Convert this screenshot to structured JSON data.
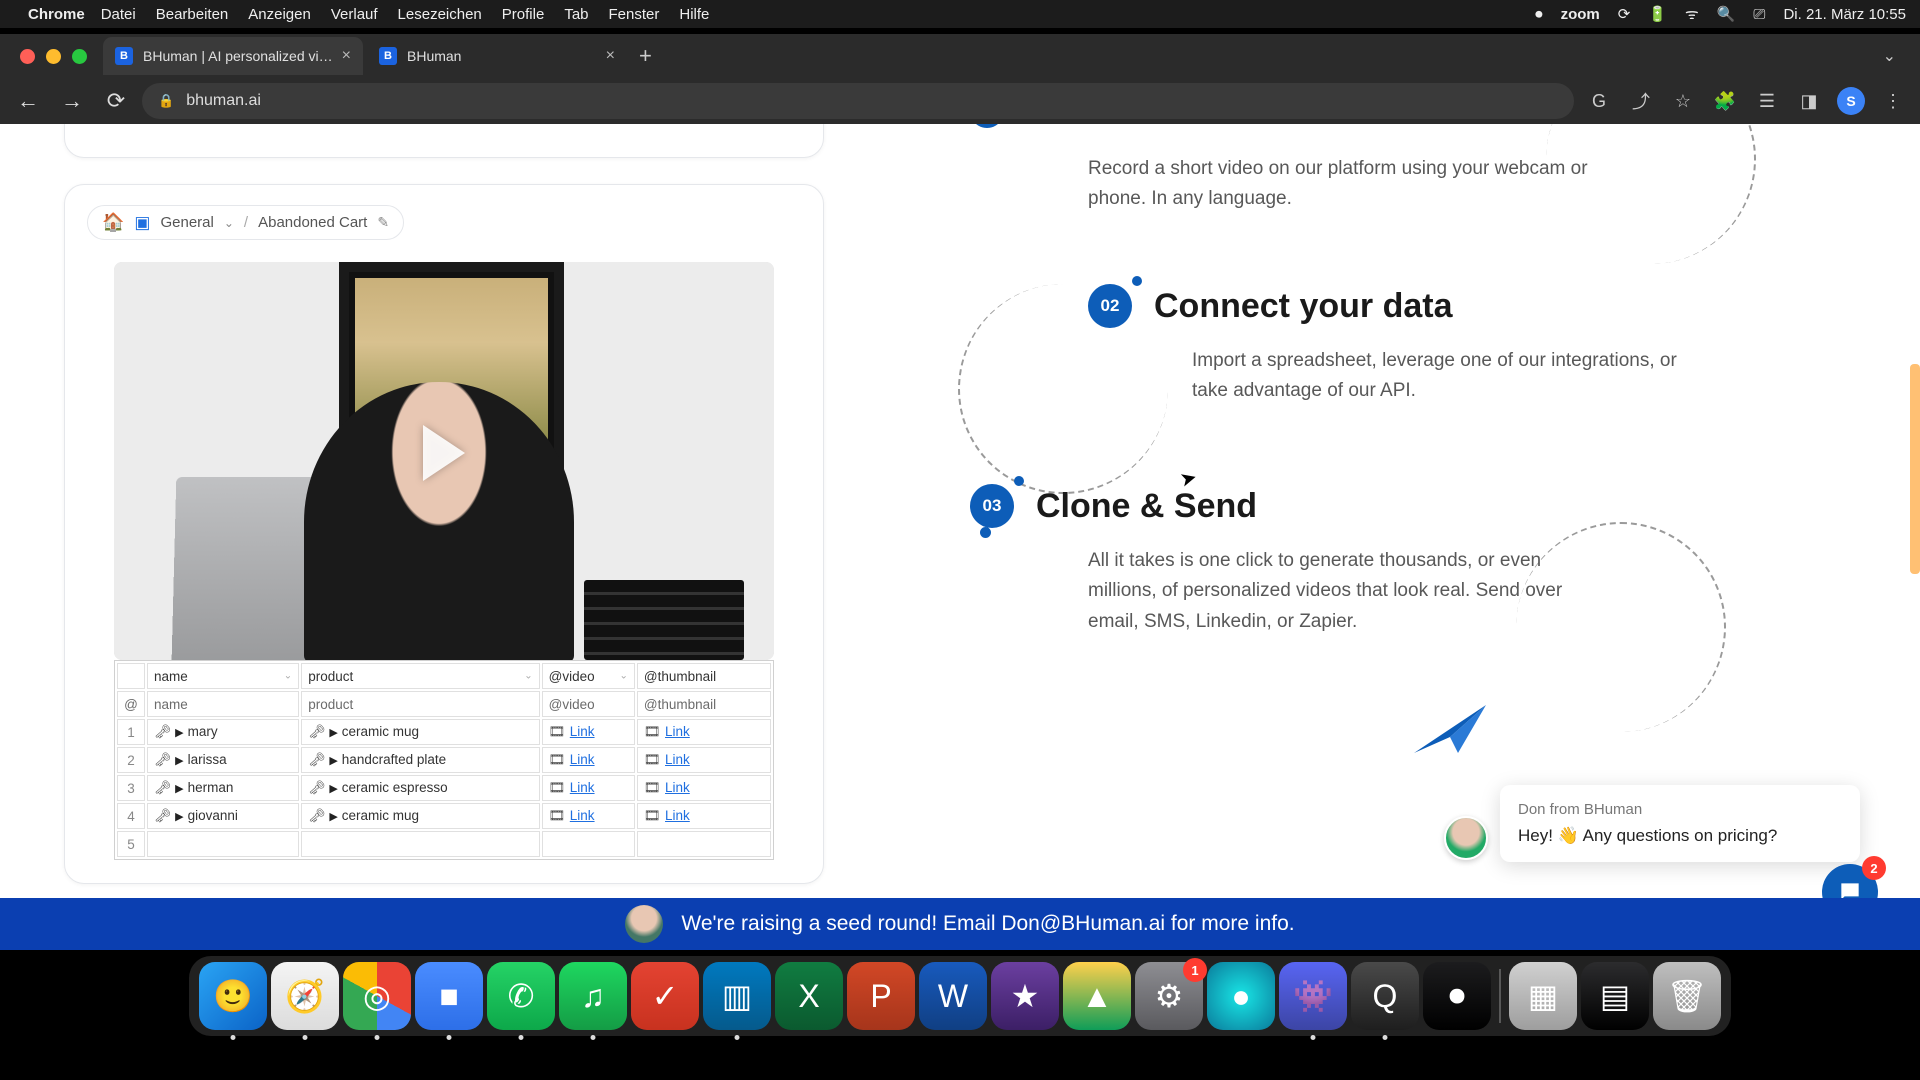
{
  "menubar": {
    "app": "Chrome",
    "items": [
      "Datei",
      "Bearbeiten",
      "Anzeigen",
      "Verlauf",
      "Lesezeichen",
      "Profile",
      "Tab",
      "Fenster",
      "Hilfe"
    ],
    "zoom_label": "zoom",
    "clock": "Di. 21. März  10:55"
  },
  "tabs": [
    {
      "favicon": "B",
      "title": "BHuman | AI personalized vide…",
      "active": true
    },
    {
      "favicon": "B",
      "title": "BHuman",
      "active": false
    }
  ],
  "address": {
    "url_text": "bhuman.ai",
    "profile_initial": "S"
  },
  "breadcrumb": {
    "folder": "General",
    "page": "Abandoned Cart"
  },
  "sheet": {
    "headers": [
      "name",
      "product",
      "@video",
      "@thumbnail"
    ],
    "subheaders": [
      "@",
      "name",
      "product",
      "@video",
      "@thumbnail"
    ],
    "rows": [
      {
        "n": "1",
        "name": "mary",
        "product": "ceramic mug",
        "video": "Link",
        "thumb": "Link"
      },
      {
        "n": "2",
        "name": "larissa",
        "product": "handcrafted plate",
        "video": "Link",
        "thumb": "Link"
      },
      {
        "n": "3",
        "name": "herman",
        "product": "ceramic espresso",
        "video": "Link",
        "thumb": "Link"
      },
      {
        "n": "4",
        "name": "giovanni",
        "product": "ceramic mug",
        "video": "Link",
        "thumb": "Link"
      },
      {
        "n": "5",
        "name": "",
        "product": "",
        "video": "",
        "thumb": ""
      }
    ]
  },
  "steps": {
    "s1_body": "Record a short video on our platform using your webcam or phone. In any language.",
    "s2_num": "02",
    "s2_title": "Connect your data",
    "s2_body": "Import a spreadsheet, leverage one of our integrations, or take advantage of our API.",
    "s3_num": "03",
    "s3_title": "Clone & Send",
    "s3_body": "All it takes is one click to generate thousands, or even millions, of personalized videos that look real. Send over email, SMS, Linkedin, or Zapier."
  },
  "chat": {
    "from": "Don from BHuman",
    "msg": "Hey! 👋 Any questions on pricing?",
    "badge": "2"
  },
  "banner": {
    "text": "We're raising a seed round! Email Don@BHuman.ai for more info."
  },
  "dock": {
    "items": [
      {
        "name": "finder",
        "glyph": "🙂",
        "bg": "linear-gradient(135deg,#2aa4f4,#0b63c7)",
        "running": true
      },
      {
        "name": "safari",
        "glyph": "🧭",
        "bg": "linear-gradient(#f4f4f4,#dcdcdc)",
        "running": true
      },
      {
        "name": "chrome",
        "glyph": "◎",
        "bg": "conic-gradient(#ea4335 0 33%,#4285f4 33% 50%,#34a853 50% 83%,#fbbc05 83% 100%)",
        "running": true
      },
      {
        "name": "zoom",
        "glyph": "■",
        "bg": "linear-gradient(#4a8cff,#2d6fe8)",
        "running": true
      },
      {
        "name": "whatsapp",
        "glyph": "✆",
        "bg": "linear-gradient(#25d366,#0da84a)",
        "running": true
      },
      {
        "name": "spotify",
        "glyph": "♫",
        "bg": "linear-gradient(#1ed760,#149c45)",
        "running": true
      },
      {
        "name": "todoist",
        "glyph": "✓",
        "bg": "linear-gradient(#e44332,#c8321f)",
        "running": false
      },
      {
        "name": "trello",
        "glyph": "▥",
        "bg": "linear-gradient(#0079bf,#055a8c)",
        "running": true
      },
      {
        "name": "excel",
        "glyph": "X",
        "bg": "linear-gradient(#107c41,#0b5a2f)",
        "running": false
      },
      {
        "name": "powerpoint",
        "glyph": "P",
        "bg": "linear-gradient(#d24726,#a6351b)",
        "running": false
      },
      {
        "name": "word",
        "glyph": "W",
        "bg": "linear-gradient(#185abd,#103f83)",
        "running": false
      },
      {
        "name": "imovie",
        "glyph": "★",
        "bg": "linear-gradient(#6b3fa0,#3c1f66)",
        "running": false
      },
      {
        "name": "google-drive",
        "glyph": "▲",
        "bg": "linear-gradient(#ffd04c,#0f9d58)",
        "running": false
      },
      {
        "name": "settings",
        "glyph": "⚙",
        "bg": "linear-gradient(#8e8e93,#5a5a5e)",
        "running": false,
        "badge": "1"
      },
      {
        "name": "siri",
        "glyph": "●",
        "bg": "radial-gradient(circle,#19e6e6,#0a7a9a)",
        "running": false
      },
      {
        "name": "discord",
        "glyph": "👾",
        "bg": "linear-gradient(#5865f2,#3c45a5)",
        "running": true
      },
      {
        "name": "quicktime",
        "glyph": "Q",
        "bg": "linear-gradient(#4a4a4a,#1e1e1e)",
        "running": true
      },
      {
        "name": "voice-memos",
        "glyph": "⏺",
        "bg": "linear-gradient(#1c1c1e,#000)",
        "running": false
      }
    ],
    "right": [
      {
        "name": "calculator",
        "glyph": "▦",
        "bg": "linear-gradient(#d0d0d0,#9e9e9e)"
      },
      {
        "name": "stocks",
        "glyph": "▤",
        "bg": "linear-gradient(#2c2c2e,#000)"
      },
      {
        "name": "trash",
        "glyph": "🗑",
        "bg": "linear-gradient(#bfbfbf,#8a8a8a)"
      }
    ]
  }
}
